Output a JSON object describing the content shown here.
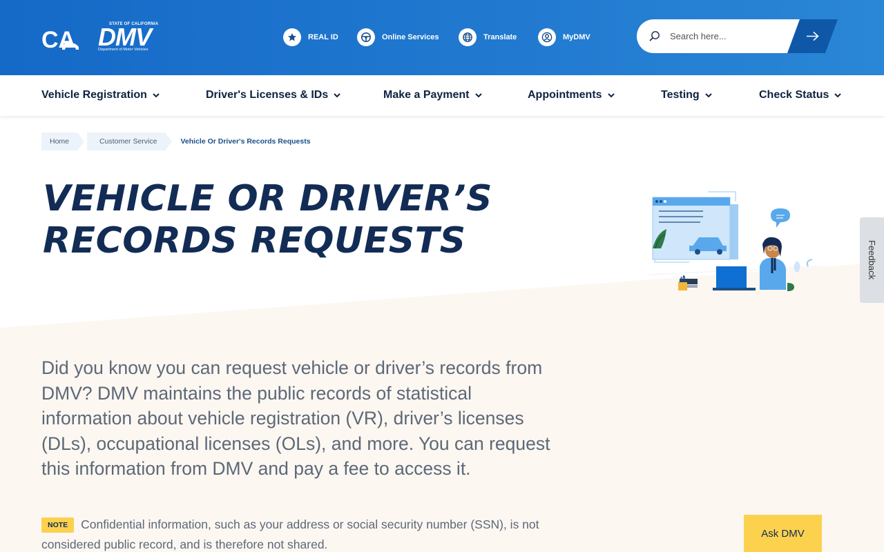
{
  "header": {
    "ca_logo_text": "CA",
    "dmv_logo": {
      "state_text": "STATE OF CALIFORNIA",
      "word": "DMV",
      "sub_text": "Department of Motor Vehicles"
    },
    "utility_links": [
      {
        "label": "REAL ID",
        "icon": "star-icon"
      },
      {
        "label": "Online Services",
        "icon": "steering-wheel-icon"
      },
      {
        "label": "Translate",
        "icon": "globe-icon"
      },
      {
        "label": "MyDMV",
        "icon": "user-icon"
      }
    ],
    "search": {
      "placeholder": "Search here...",
      "value": ""
    }
  },
  "nav": {
    "items": [
      {
        "label": "Vehicle Registration"
      },
      {
        "label": "Driver's Licenses & IDs"
      },
      {
        "label": "Make a Payment"
      },
      {
        "label": "Appointments"
      },
      {
        "label": "Testing"
      },
      {
        "label": "Check Status"
      }
    ]
  },
  "breadcrumb": {
    "items": [
      "Home",
      "Customer Service"
    ],
    "current": "Vehicle Or Driver's Records Requests"
  },
  "page": {
    "title_line1": "Vehicle or Driver’s",
    "title_line2": "Records Requests",
    "intro": "Did you know you can request vehicle or driver’s records from DMV? DMV maintains the public records of statistical information about vehicle registration (VR), driver’s licenses (DLs), occupational licenses (OLs), and more. You can request this information from DMV and pay a fee to access it.",
    "note_label": "NOTE",
    "note_text": "Confidential information, such as your address or social security number (SSN), is not considered public record, and is therefore not shared."
  },
  "widgets": {
    "ask_label": "Ask DMV",
    "feedback_label": "Feedback"
  },
  "colors": {
    "header_blue": "#1569c7",
    "title_navy": "#132c55",
    "accent_yellow": "#fcd14d",
    "cream_bg": "#fcf7f1"
  }
}
